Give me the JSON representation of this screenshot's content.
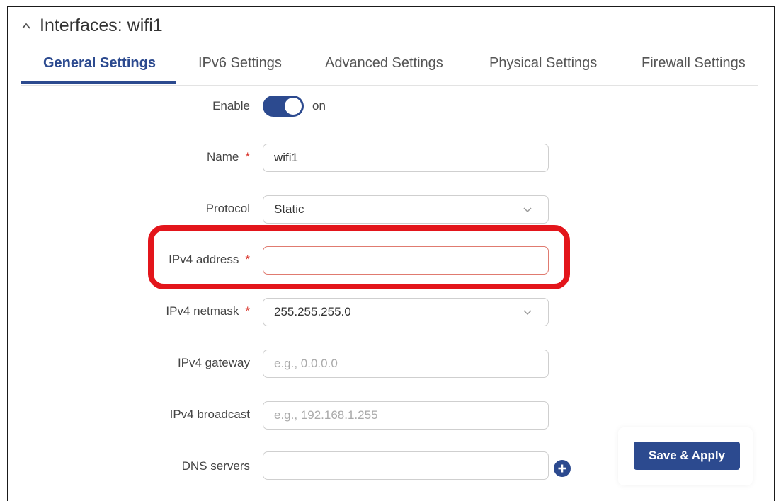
{
  "section": {
    "title": "Interfaces: wifi1"
  },
  "tabs": [
    {
      "label": "General Settings"
    },
    {
      "label": "IPv6 Settings"
    },
    {
      "label": "Advanced Settings"
    },
    {
      "label": "Physical Settings"
    },
    {
      "label": "Firewall Settings"
    }
  ],
  "form": {
    "enable": {
      "label": "Enable",
      "state": "on"
    },
    "name": {
      "label": "Name",
      "value": "wifi1",
      "required": "*"
    },
    "protocol": {
      "label": "Protocol",
      "value": "Static"
    },
    "ipv4_address": {
      "label": "IPv4 address",
      "value": "",
      "required": "*"
    },
    "ipv4_netmask": {
      "label": "IPv4 netmask",
      "value": "255.255.255.0",
      "required": "*"
    },
    "ipv4_gateway": {
      "label": "IPv4 gateway",
      "placeholder": "e.g., 0.0.0.0"
    },
    "ipv4_broadcast": {
      "label": "IPv4 broadcast",
      "placeholder": "e.g., 192.168.1.255"
    },
    "dns_servers": {
      "label": "DNS servers",
      "value": ""
    }
  },
  "actions": {
    "save_label": "Save & Apply"
  },
  "colors": {
    "accent": "#2c4a8f",
    "required": "#d9342b",
    "highlight": "#e3151b"
  },
  "icons": {
    "collapse": "chevron-up-icon",
    "dropdown": "chevron-down-icon",
    "add": "plus-circle-icon"
  }
}
